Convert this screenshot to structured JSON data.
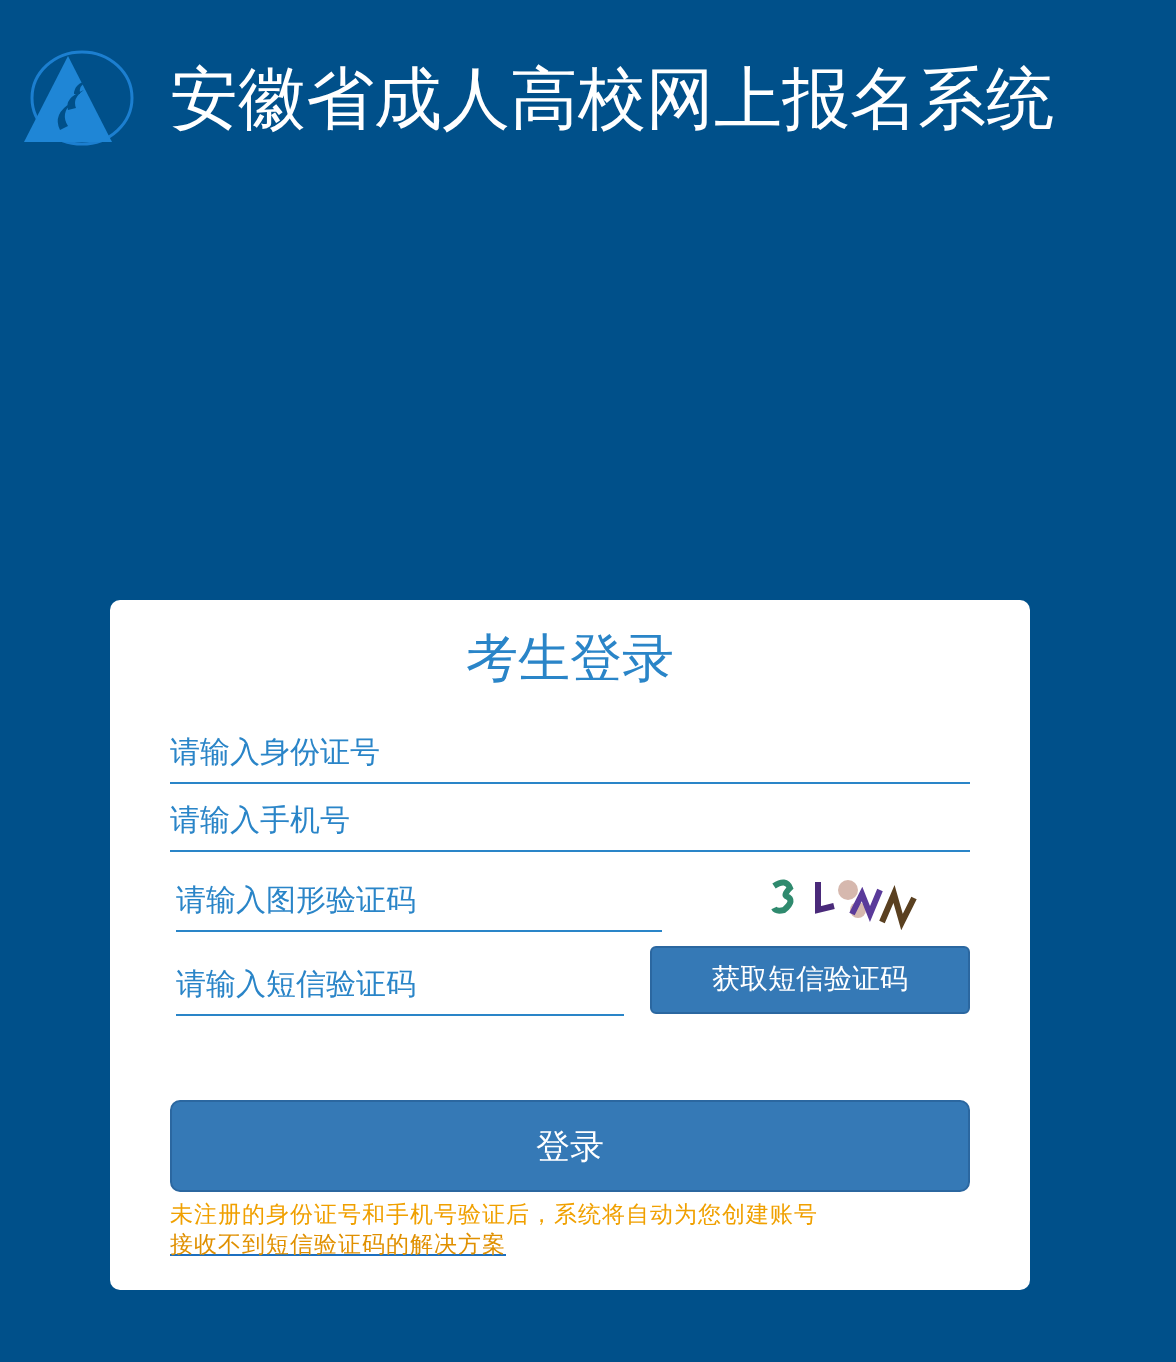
{
  "header": {
    "title": "安徽省成人高校网上报名系统"
  },
  "login": {
    "title": "考生登录",
    "fields": [
      {
        "kind": "full",
        "placeholder": "请输入身份证号"
      },
      {
        "kind": "full",
        "placeholder": "请输入手机号"
      },
      {
        "kind": "captcha",
        "placeholder": "请输入图形验证码"
      },
      {
        "kind": "sms",
        "placeholder": "请输入短信验证码",
        "button": "获取短信验证码"
      }
    ],
    "submit": "登录",
    "notice": "未注册的身份证号和手机号验证后，系统将自动为您创建账号",
    "help_link": "接收不到短信验证码的解决方案"
  }
}
